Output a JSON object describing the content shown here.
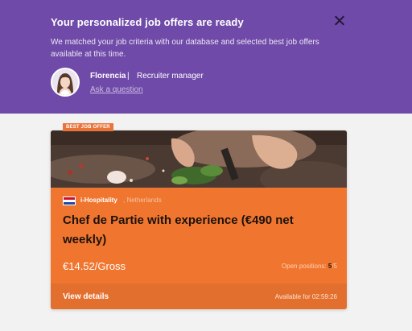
{
  "banner": {
    "title": "Your personalized job offers are ready",
    "text": "We matched your job criteria with our database and selected best job offers available at this time.",
    "recruiter_name": "Florencia",
    "separator": "|",
    "recruiter_role": "Recruiter manager",
    "ask_link": "Ask a question"
  },
  "card": {
    "badge": "BEST JOB OFFER",
    "company": "i-Hospitality",
    "country": ", Netherlands",
    "title": "Chef de Partie with experience (€490 net weekly)",
    "salary": "€14.52/Gross",
    "positions_label": "Open positions:",
    "positions_open": "5",
    "positions_total": "/5",
    "view_details": "View details",
    "available_label": "Available for",
    "available_time": "02:59:26"
  },
  "colors": {
    "banner": "#6f4aa8",
    "card": "#f07630",
    "card_footer": "#e26f2e"
  },
  "icons": {
    "close": "close-icon",
    "flag": "netherlands-flag-icon"
  }
}
